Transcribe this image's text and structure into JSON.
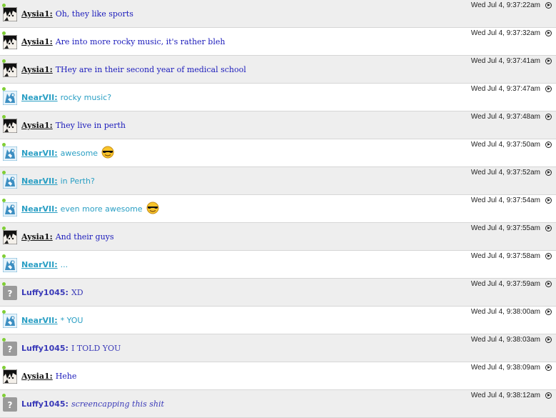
{
  "messages": [
    {
      "user": "Aysia1:",
      "type": "aysia",
      "text": "Oh, they like sports",
      "time": "Wed Jul 4, 9:37:22am"
    },
    {
      "user": "Aysia1:",
      "type": "aysia",
      "text": "Are into more rocky music, it's rather bleh",
      "time": "Wed Jul 4, 9:37:32am"
    },
    {
      "user": "Aysia1:",
      "type": "aysia",
      "text": "THey are in their second year of medical school",
      "time": "Wed Jul 4, 9:37:41am"
    },
    {
      "user": "NearVII:",
      "type": "near",
      "text": "rocky music?",
      "time": "Wed Jul 4, 9:37:47am"
    },
    {
      "user": "Aysia1:",
      "type": "aysia",
      "text": "They live in perth",
      "time": "Wed Jul 4, 9:37:48am"
    },
    {
      "user": "NearVII:",
      "type": "near",
      "text": "awesome",
      "time": "Wed Jul 4, 9:37:50am",
      "emoticon": "sunglasses-emoticon"
    },
    {
      "user": "NearVII:",
      "type": "near",
      "text": "in Perth?",
      "time": "Wed Jul 4, 9:37:52am"
    },
    {
      "user": "NearVII:",
      "type": "near",
      "text": "even more awesome",
      "time": "Wed Jul 4, 9:37:54am",
      "emoticon": "sunglasses-emoticon"
    },
    {
      "user": "Aysia1:",
      "type": "aysia",
      "text": "And their guys",
      "time": "Wed Jul 4, 9:37:55am"
    },
    {
      "user": "NearVII:",
      "type": "near",
      "text": "...",
      "time": "Wed Jul 4, 9:37:58am"
    },
    {
      "user": "Luffy1045:",
      "type": "luffy",
      "text": "XD",
      "time": "Wed Jul 4, 9:37:59am"
    },
    {
      "user": "NearVII:",
      "type": "near",
      "text": "* YOU",
      "time": "Wed Jul 4, 9:38:00am"
    },
    {
      "user": "Luffy1045:",
      "type": "luffy",
      "text": "I TOLD YOU",
      "time": "Wed Jul 4, 9:38:03am"
    },
    {
      "user": "Aysia1:",
      "type": "aysia",
      "text": "Hehe",
      "time": "Wed Jul 4, 9:38:09am"
    },
    {
      "user": "Luffy1045:",
      "type": "luffy",
      "text": "screencapping this shit",
      "time": "Wed Jul 4, 9:38:12am",
      "italic": true
    }
  ],
  "icons": {
    "status": "online-status-icon",
    "more": "message-options-icon",
    "unknown_avatar": "question-mark-avatar-icon"
  },
  "colors": {
    "aysia_name": "#111111",
    "aysia_text": "#1a1abb",
    "near": "#2a9fc4",
    "luffy": "#3a3ab8",
    "online_dot": "#7fce35",
    "row_alt": "#eeeeee"
  }
}
